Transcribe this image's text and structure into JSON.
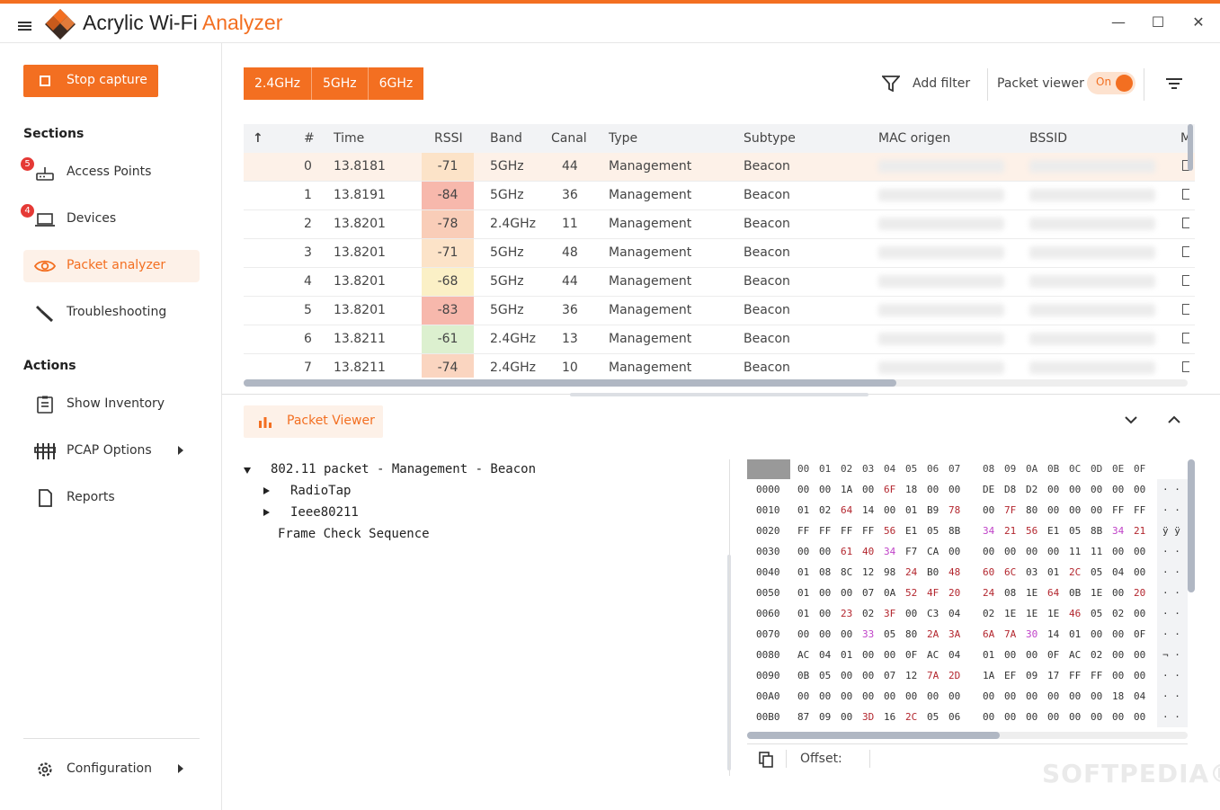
{
  "app": {
    "title_main": "Acrylic Wi-Fi ",
    "title_accent": "Analyzer",
    "window_buttons": [
      "minimize",
      "maximize",
      "close"
    ]
  },
  "colors": {
    "accent": "#f36f21",
    "badge": "#e53935"
  },
  "sidebar": {
    "stop_capture": "Stop capture",
    "sections_title": "Sections",
    "sections": [
      {
        "label": "Access Points",
        "icon": "router-icon",
        "badge": "5"
      },
      {
        "label": "Devices",
        "icon": "laptop-icon",
        "badge": "4"
      },
      {
        "label": "Packet analyzer",
        "icon": "eye-icon",
        "active": true
      },
      {
        "label": "Troubleshooting",
        "icon": "wrench-icon"
      }
    ],
    "actions_title": "Actions",
    "actions": [
      {
        "label": "Show Inventory",
        "icon": "clipboard-icon"
      },
      {
        "label": "PCAP Options",
        "icon": "sliders-icon",
        "submenu": true
      },
      {
        "label": "Reports",
        "icon": "document-icon"
      }
    ],
    "configuration": "Configuration"
  },
  "toolbar": {
    "bands": [
      "2.4GHz",
      "5GHz",
      "6GHz"
    ],
    "add_filter": "Add filter",
    "packet_viewer": "Packet viewer",
    "toggle_state": "On"
  },
  "table": {
    "sort_indicator": "↑",
    "columns": [
      "#",
      "Time",
      "RSSI",
      "Band",
      "Canal",
      "Type",
      "Subtype",
      "MAC origen",
      "BSSID",
      "M"
    ],
    "rows": [
      {
        "num": "0",
        "time": "13.8181",
        "rssi": "-71",
        "rssi_color": "#fce3c8",
        "band": "5GHz",
        "canal": "44",
        "type": "Management",
        "subtype": "Beacon"
      },
      {
        "num": "1",
        "time": "13.8191",
        "rssi": "-84",
        "rssi_color": "#f7b8ac",
        "band": "5GHz",
        "canal": "36",
        "type": "Management",
        "subtype": "Beacon"
      },
      {
        "num": "2",
        "time": "13.8201",
        "rssi": "-78",
        "rssi_color": "#f9cdb8",
        "band": "2.4GHz",
        "canal": "11",
        "type": "Management",
        "subtype": "Beacon"
      },
      {
        "num": "3",
        "time": "13.8201",
        "rssi": "-71",
        "rssi_color": "#fce3c8",
        "band": "5GHz",
        "canal": "48",
        "type": "Management",
        "subtype": "Beacon"
      },
      {
        "num": "4",
        "time": "13.8201",
        "rssi": "-68",
        "rssi_color": "#fbf0c6",
        "band": "5GHz",
        "canal": "44",
        "type": "Management",
        "subtype": "Beacon"
      },
      {
        "num": "5",
        "time": "13.8201",
        "rssi": "-83",
        "rssi_color": "#f7b8ac",
        "band": "5GHz",
        "canal": "36",
        "type": "Management",
        "subtype": "Beacon"
      },
      {
        "num": "6",
        "time": "13.8211",
        "rssi": "-61",
        "rssi_color": "#dcf0cf",
        "band": "2.4GHz",
        "canal": "13",
        "type": "Management",
        "subtype": "Beacon"
      },
      {
        "num": "7",
        "time": "13.8211",
        "rssi": "-74",
        "rssi_color": "#fad5c0",
        "band": "2.4GHz",
        "canal": "10",
        "type": "Management",
        "subtype": "Beacon"
      }
    ]
  },
  "viewer": {
    "tab_label": "Packet Viewer",
    "tree": [
      {
        "label": "802.11 packet - Management - Beacon",
        "expanded": true
      },
      {
        "label": "RadioTap",
        "expanded": false
      },
      {
        "label": "Ieee80211",
        "expanded": false
      },
      {
        "label": "Frame Check Sequence"
      }
    ],
    "hex_header": [
      "00",
      "01",
      "02",
      "03",
      "04",
      "05",
      "06",
      "07",
      "08",
      "09",
      "0A",
      "0B",
      "0C",
      "0D",
      "0E",
      "0F"
    ],
    "hex_rows": [
      {
        "offset": "0000",
        "bytes": [
          "00",
          "00",
          "1A",
          "00",
          "6F:r",
          "18",
          "00",
          "00",
          "DE",
          "D8",
          "D2",
          "00",
          "00",
          "00",
          "00",
          "00"
        ],
        "ascii": "· ·"
      },
      {
        "offset": "0010",
        "bytes": [
          "01",
          "02",
          "64:r",
          "14",
          "00",
          "01",
          "B9",
          "78:r",
          "00",
          "7F:r",
          "80",
          "00",
          "00",
          "00",
          "FF",
          "FF"
        ],
        "ascii": "· ·"
      },
      {
        "offset": "0020",
        "bytes": [
          "FF",
          "FF",
          "FF",
          "FF",
          "56:r",
          "E1",
          "05",
          "8B",
          "34:p",
          "21:r",
          "56:r",
          "E1",
          "05",
          "8B",
          "34:p",
          "21:r"
        ],
        "ascii": "ÿ ÿ"
      },
      {
        "offset": "0030",
        "bytes": [
          "00",
          "00",
          "61:r",
          "40:r",
          "34:p",
          "F7",
          "CA",
          "00",
          "00",
          "00",
          "00",
          "00",
          "11",
          "11",
          "00",
          "00"
        ],
        "ascii": "· ·"
      },
      {
        "offset": "0040",
        "bytes": [
          "01",
          "08",
          "8C",
          "12",
          "98",
          "24:r",
          "B0",
          "48:r",
          "60:r",
          "6C:r",
          "03",
          "01",
          "2C:r",
          "05",
          "04",
          "00"
        ],
        "ascii": "· ·"
      },
      {
        "offset": "0050",
        "bytes": [
          "01",
          "00",
          "00",
          "07",
          "0A",
          "52:r",
          "4F:r",
          "20:r",
          "24:r",
          "08",
          "1E",
          "64:r",
          "0B",
          "1E",
          "00",
          "20:r"
        ],
        "ascii": "· ·"
      },
      {
        "offset": "0060",
        "bytes": [
          "01",
          "00",
          "23:r",
          "02",
          "3F:r",
          "00",
          "C3",
          "04",
          "02",
          "1E",
          "1E",
          "1E",
          "46:r",
          "05",
          "02",
          "00"
        ],
        "ascii": "· ·"
      },
      {
        "offset": "0070",
        "bytes": [
          "00",
          "00",
          "00",
          "33:p",
          "05",
          "80",
          "2A:r",
          "3A:r",
          "6A:r",
          "7A:r",
          "30:p",
          "14",
          "01",
          "00",
          "00",
          "0F"
        ],
        "ascii": "· ·"
      },
      {
        "offset": "0080",
        "bytes": [
          "AC",
          "04",
          "01",
          "00",
          "00",
          "0F",
          "AC",
          "04",
          "01",
          "00",
          "00",
          "0F",
          "AC",
          "02",
          "00",
          "00"
        ],
        "ascii": "¬ ·"
      },
      {
        "offset": "0090",
        "bytes": [
          "0B",
          "05",
          "00",
          "00",
          "07",
          "12",
          "7A:r",
          "2D:r",
          "1A",
          "EF",
          "09",
          "17",
          "FF",
          "FF",
          "00",
          "00"
        ],
        "ascii": "· ·"
      },
      {
        "offset": "00A0",
        "bytes": [
          "00",
          "00",
          "00",
          "00",
          "00",
          "00",
          "00",
          "00",
          "00",
          "00",
          "00",
          "00",
          "00",
          "00",
          "18",
          "04"
        ],
        "ascii": "· ·"
      },
      {
        "offset": "00B0",
        "bytes": [
          "87",
          "09",
          "00",
          "3D:r",
          "16",
          "2C:r",
          "05",
          "06",
          "00",
          "00",
          "00",
          "00",
          "00",
          "00",
          "00",
          "00"
        ],
        "ascii": "· ·"
      }
    ],
    "offset_label": "Offset:"
  },
  "watermark": "SOFTPEDIA®"
}
